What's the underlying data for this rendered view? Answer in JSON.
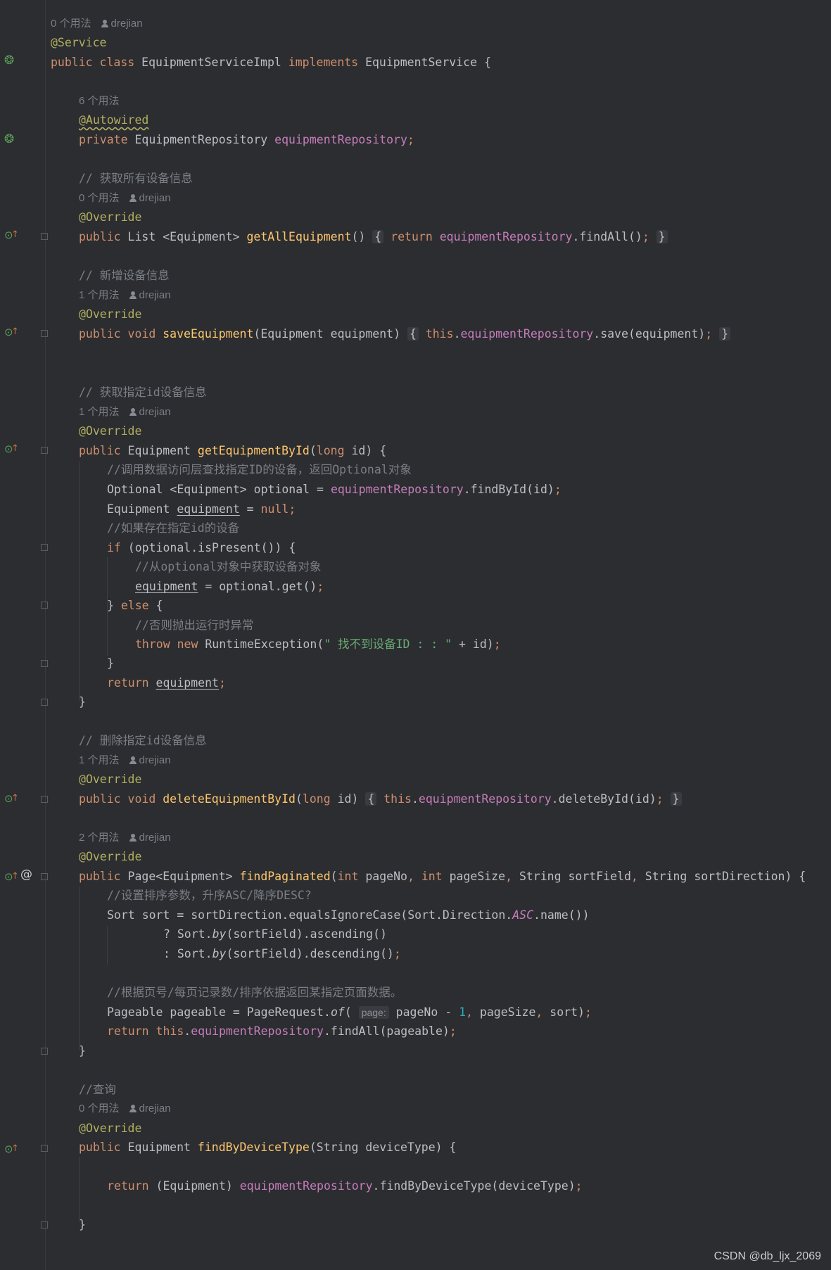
{
  "hints": {
    "usages_0": "0 个用法",
    "usages_1": "1 个用法",
    "usages_2": "2 个用法",
    "usages_6": "6 个用法",
    "author": "drejian",
    "param_page": "page:"
  },
  "code": {
    "ann_service": "@Service",
    "ann_autowired": "@Autowired",
    "ann_override": "@Override",
    "kw_public": "public",
    "kw_private": "private",
    "kw_class": "class",
    "kw_implements": "implements",
    "kw_return": "return",
    "kw_void": "void",
    "kw_this": "this",
    "kw_long": "long",
    "kw_null": "null",
    "kw_if": "if",
    "kw_else": "else",
    "kw_throw": "throw",
    "kw_new": "new",
    "kw_int": "int",
    "class_name": "EquipmentServiceImpl",
    "interface_name": "EquipmentService",
    "repo_type": "EquipmentRepository",
    "repo_field": "equipmentRepository",
    "type_list": "List",
    "type_equipment": "Equipment",
    "type_generic_equipment": "<Equipment>",
    "type_optional": "Optional",
    "type_page": "Page",
    "type_string": "String",
    "type_sort": "Sort",
    "type_pageable": "Pageable",
    "type_pagerequest": "PageRequest",
    "type_runtime_exception": "RuntimeException",
    "m_get_all": "getAllEquipment",
    "m_save": "saveEquipment",
    "m_get_by_id": "getEquipmentById",
    "m_delete_by_id": "deleteEquipmentById",
    "m_find_paginated": "findPaginated",
    "m_find_by_device_type": "findByDeviceType",
    "call_find_all": "findAll",
    "call_save": "save",
    "call_find_by_id": "findById",
    "call_is_present": "isPresent",
    "call_get": "get",
    "call_delete_by_id": "deleteById",
    "call_equals_ignore_case": "equalsIgnoreCase",
    "call_name": "name",
    "call_by": "by",
    "call_ascending": "ascending",
    "call_descending": "descending",
    "call_of": "of",
    "call_find_by_device_type": "findByDeviceType",
    "var_equipment": "equipment",
    "var_optional": "optional",
    "var_id": "id",
    "var_sort": "sort",
    "var_pageable": "pageable",
    "var_page_no": "pageNo",
    "var_page_size": "pageSize",
    "var_sort_field": "sortField",
    "var_sort_direction": "sortDirection",
    "var_device_type": "deviceType",
    "sort_direction": "Sort.Direction.",
    "const_asc": "ASC",
    "num_one": "1",
    "exception_message": "\" 找不到设备ID : : \"",
    "comment_get_all": "// 获取所有设备信息",
    "comment_add": "// 新增设备信息",
    "comment_get_by_id": "// 获取指定id设备信息",
    "comment_call_dao": "//调用数据访问层查找指定ID的设备，返回Optional对象",
    "comment_if_exists": "//如果存在指定id的设备",
    "comment_get_from_optional": "//从optional对象中获取设备对象",
    "comment_else_throw": "//否则抛出运行时异常",
    "comment_delete": "// 删除指定id设备信息",
    "comment_sort_params": "//设置排序参数，升序ASC/降序DESC?",
    "comment_page_data": "//根据页号/每页记录数/排序依据返回某指定页面数据。",
    "comment_query": "//查询"
  },
  "watermark": "CSDN @db_ljx_2069"
}
